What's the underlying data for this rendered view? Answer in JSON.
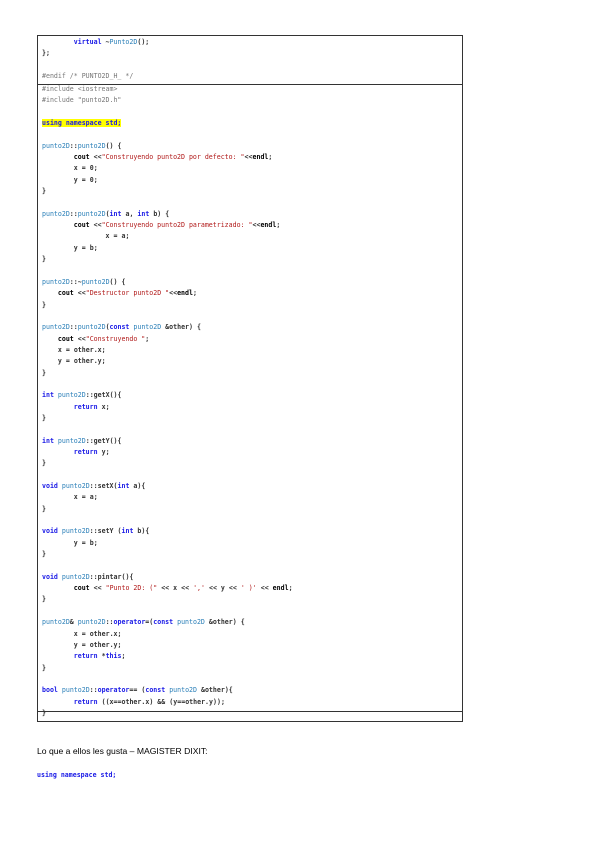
{
  "code_top": [
    "        virtual ~Punto2D();",
    "};",
    "",
    "#endif /* PUNTO2D_H_ */"
  ],
  "code_main": [
    "#include <iostream>",
    "#include \"punto2D.h\"",
    "",
    "using namespace std;",
    "",
    "punto2D::punto2D() {",
    "        cout <<\"Construyendo punto2D por defecto: \"<<endl;",
    "        x = 0;",
    "        y = 0;",
    "}",
    "",
    "punto2D::punto2D(int a, int b) {",
    "        cout <<\"Construyendo punto2D parametrizado: \"<<endl;",
    "                x = a;",
    "        y = b;",
    "}",
    "",
    "punto2D::~punto2D() {",
    "    cout <<\"Destructor punto2D \"<<endl;",
    "}",
    "",
    "punto2D::punto2D(const punto2D &other) {",
    "    cout <<\"Construyendo \";",
    "    x = other.x;",
    "    y = other.y;",
    "}",
    "",
    "int punto2D::getX(){",
    "        return x;",
    "}",
    "",
    "int punto2D::getY(){",
    "        return y;",
    "}",
    "",
    "void punto2D::setX(int a){",
    "        x = a;",
    "}",
    "",
    "void punto2D::setY (int b){",
    "        y = b;",
    "}",
    "",
    "void punto2D::pintar(){",
    "        cout << \"Punto 2D: (\" << x << ',' << y << ' )' << endl;",
    "}",
    "",
    "punto2D& punto2D::operator=(const punto2D &other) {",
    "        x = other.x;",
    "        y = other.y;",
    "        return *this;",
    "}",
    "",
    "bool punto2D::operator== (const punto2D &other){",
    "        return ((x==other.x) && (y==other.y));",
    "}"
  ],
  "caption": "Lo que a ellos les gusta – MAGISTER DIXIT:",
  "tail_code": "using namespace std;",
  "colors": {
    "keyword": "#1a1ae6",
    "string": "#b11a1a",
    "preprocessor": "#777777",
    "highlight": "#ffff00"
  }
}
